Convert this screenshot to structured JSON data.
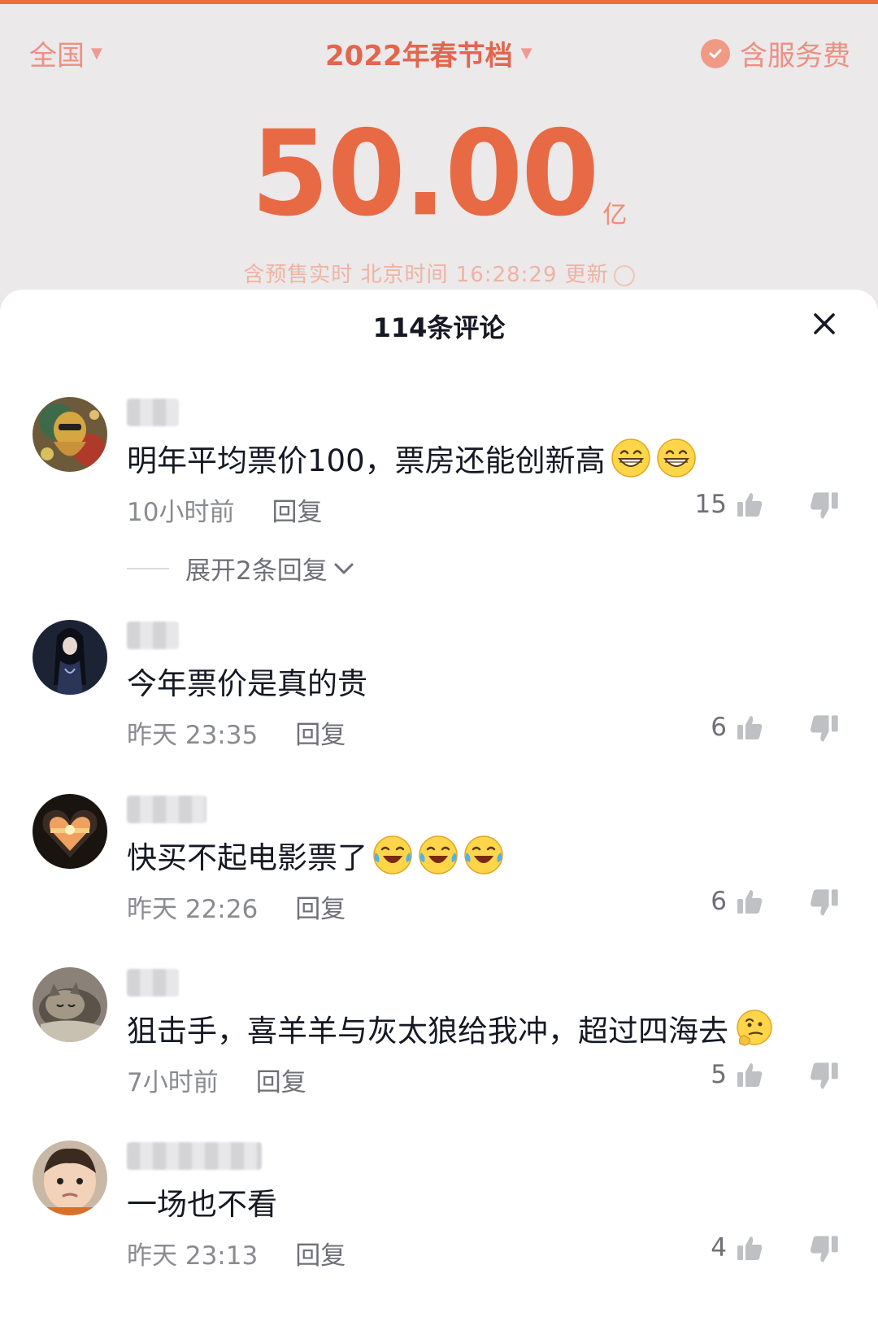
{
  "header": {
    "region": "全国",
    "period": "2022年春节档",
    "service_fee": "含服务费",
    "total": "50.00",
    "unit": "亿",
    "update_note": "含预售实时 北京时间 16:28:29 更新"
  },
  "sheet": {
    "title": "114条评论"
  },
  "comments": [
    {
      "text": "明年平均票价100，票房还能创新高",
      "emoji": [
        "grin",
        "grin"
      ],
      "time": "10小时前",
      "reply": "回复",
      "likes": "15"
    },
    {
      "text": "今年票价是真的贵",
      "emoji": [],
      "time": "昨天 23:35",
      "reply": "回复",
      "likes": "6"
    },
    {
      "text": "快买不起电影票了",
      "emoji": [
        "tears-of-joy",
        "tears-of-joy",
        "tears-of-joy"
      ],
      "time": "昨天 22:26",
      "reply": "回复",
      "likes": "6"
    },
    {
      "text": "狙击手，喜羊羊与灰太狼给我冲，超过四海去",
      "emoji": [
        "thinking"
      ],
      "time": "7小时前",
      "reply": "回复",
      "likes": "5"
    },
    {
      "text": "一场也不看",
      "emoji": [],
      "time": "昨天 23:13",
      "reply": "回复",
      "likes": "4"
    }
  ],
  "expand_replies": "展开2条回复",
  "colors": {
    "accent": "#e86a45",
    "text": "#161823",
    "meta": "#8a8b91"
  },
  "icons": [
    "close-icon",
    "thumb-up-icon",
    "thumb-down-icon",
    "chevron-down-icon",
    "check-icon",
    "info-icon"
  ]
}
